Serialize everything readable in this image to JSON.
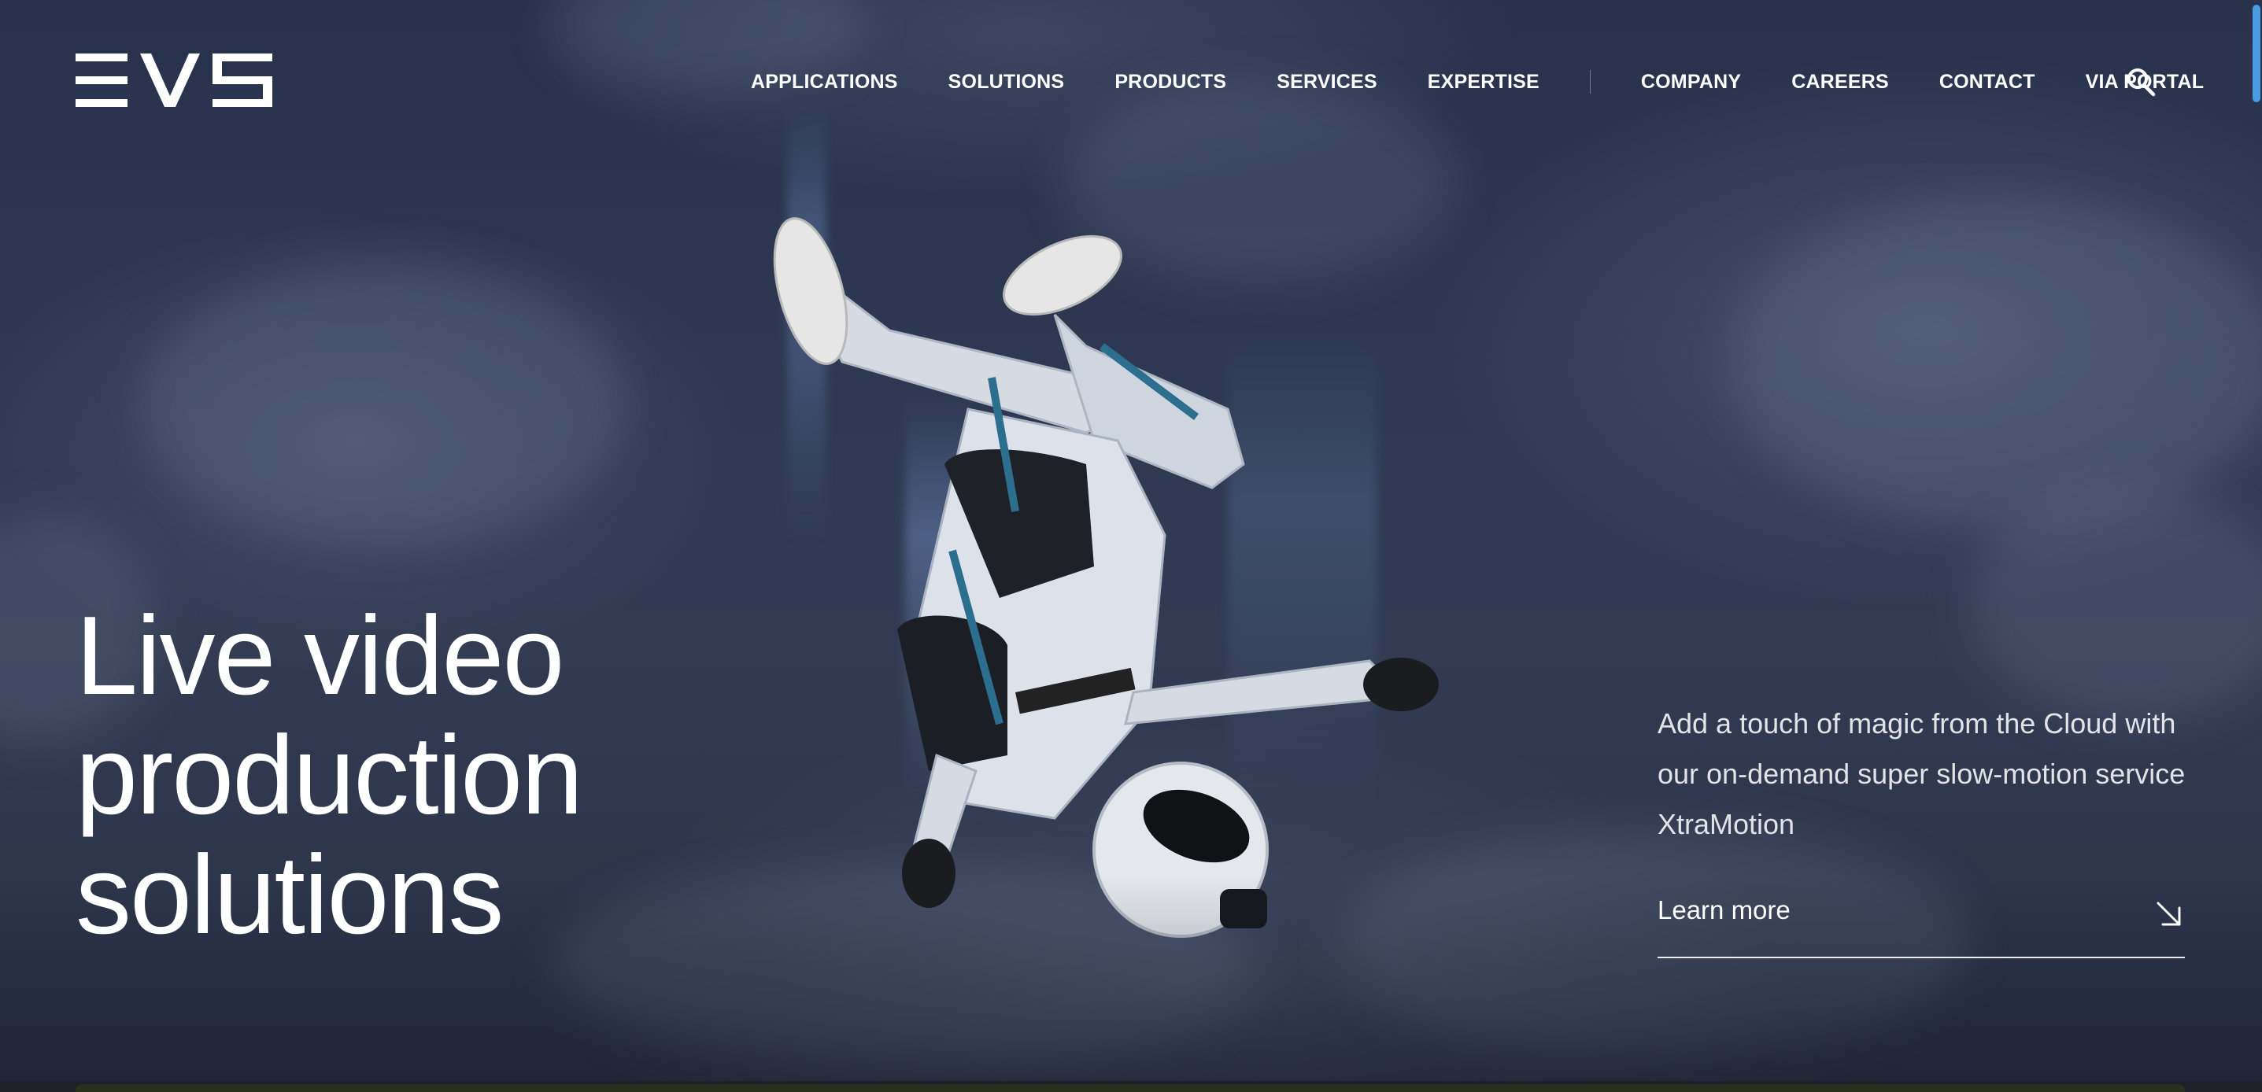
{
  "brand": {
    "logo_text": "EVS",
    "colors": {
      "text": "#ffffff",
      "accent": "#4a9be6",
      "background": "#2e3852"
    }
  },
  "nav": {
    "primary": [
      {
        "label": "APPLICATIONS"
      },
      {
        "label": "SOLUTIONS"
      },
      {
        "label": "PRODUCTS"
      },
      {
        "label": "SERVICES"
      },
      {
        "label": "EXPERTISE"
      }
    ],
    "secondary": [
      {
        "label": "COMPANY"
      },
      {
        "label": "CAREERS"
      },
      {
        "label": "CONTACT"
      },
      {
        "label": "VIA PORTAL"
      }
    ],
    "search_icon": "search-icon"
  },
  "hero": {
    "headline_lines": [
      "Live video",
      "production",
      "solutions"
    ],
    "promo_text": "Add a touch of magic from the Cloud with our on-demand super slow-motion service XtraMotion",
    "cta": {
      "label": "Learn more",
      "icon": "arrow-down-right-icon"
    }
  }
}
